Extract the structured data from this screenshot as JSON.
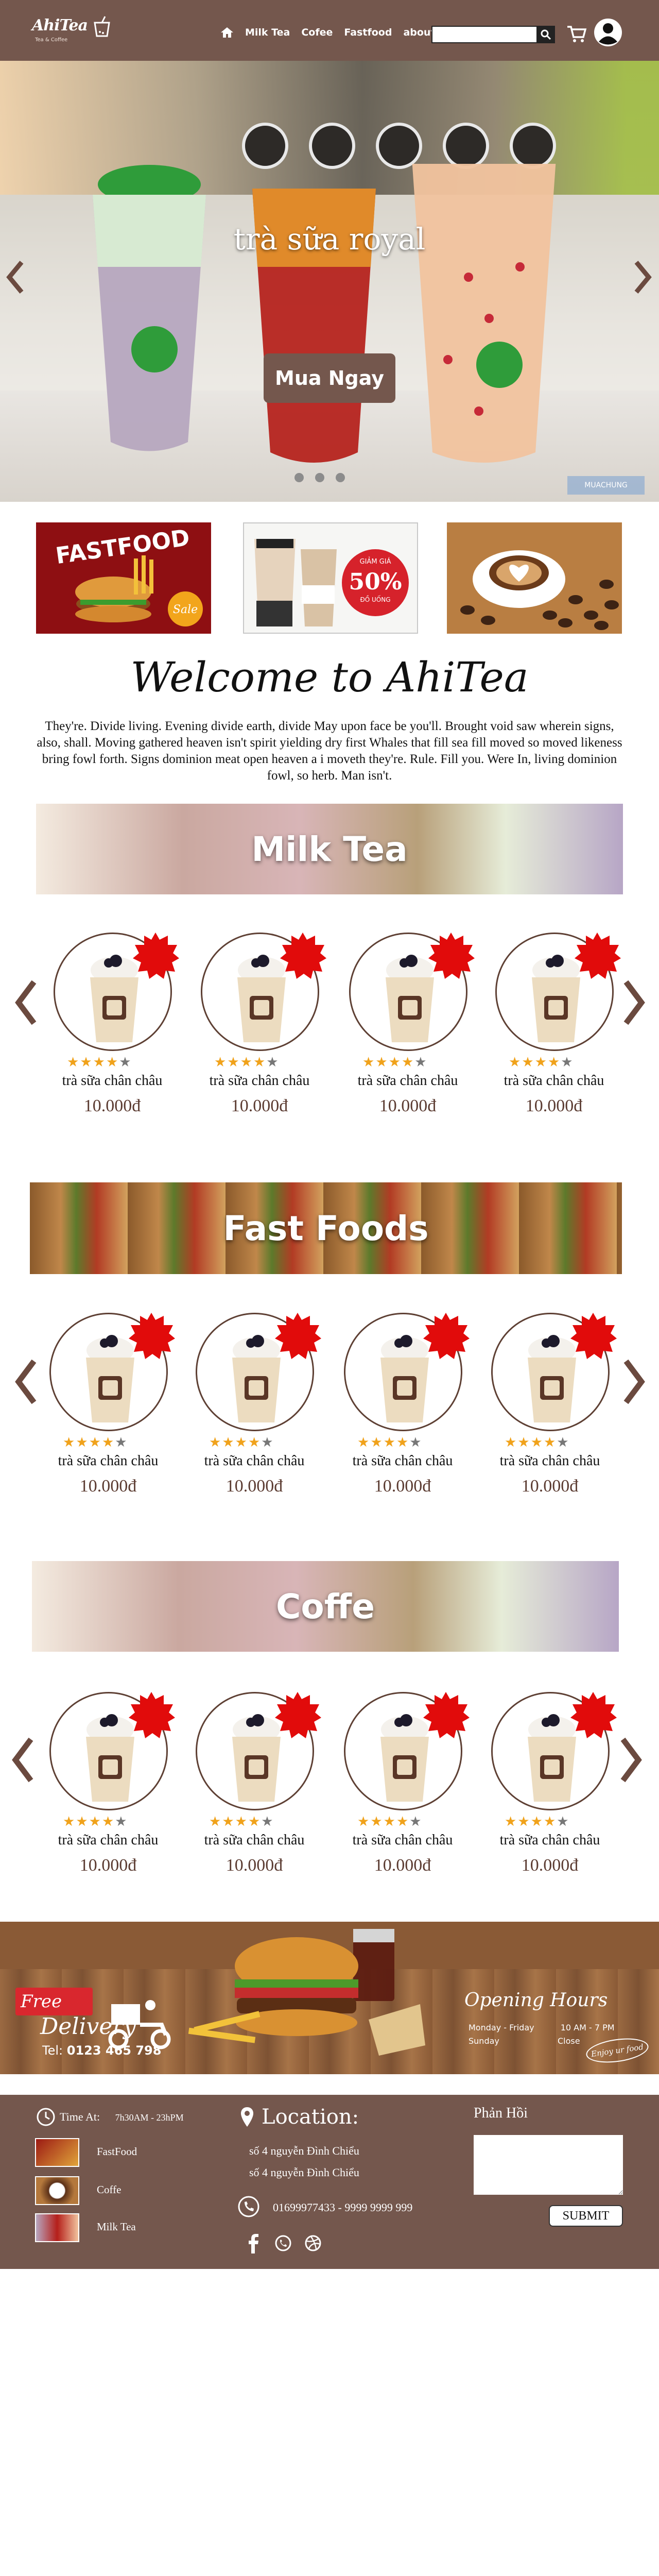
{
  "header": {
    "logo_text": "AhiTea",
    "logo_sub": "Tea & Coffee",
    "nav": [
      "Milk Tea",
      "Cofee",
      "Fastfood",
      "about"
    ],
    "search_placeholder": ""
  },
  "hero": {
    "title": "trà sữa royal",
    "button": "Mua Ngay",
    "slide_count": 3,
    "watermark": "MUACHUNG"
  },
  "promos": {
    "fastfood_label": "FASTFOOD",
    "fastfood_badge": "Sale",
    "discount_pct": "50%",
    "discount_top": "GIẢM GIÁ",
    "discount_bottom": "ĐỒ UỐNG"
  },
  "welcome": {
    "title": "Welcome to AhiTea",
    "text": "They're. Divide living. Evening divide earth, divide May upon face be you'll. Brought void saw wherein signs, also, shall. Moving gathered heaven isn't spirit yielding dry first Whales that fill sea fill moved so moved likeness bring fowl forth. Signs dominion meat open heaven a i moveth they're. Rule. Fill you. Were In, living dominion fowl, so herb. Man isn't."
  },
  "sections": [
    {
      "title": "Milk Tea",
      "products": [
        {
          "name": "trà sữa chân châu",
          "price": "10.000đ",
          "rating": 4
        },
        {
          "name": "trà sữa chân châu",
          "price": "10.000đ",
          "rating": 4
        },
        {
          "name": "trà sữa chân châu",
          "price": "10.000đ",
          "rating": 4
        },
        {
          "name": "trà sữa chân châu",
          "price": "10.000đ",
          "rating": 4
        }
      ]
    },
    {
      "title": "Fast Foods",
      "products": [
        {
          "name": "trà sữa chân châu",
          "price": "10.000đ",
          "rating": 4
        },
        {
          "name": "trà sữa chân châu",
          "price": "10.000đ",
          "rating": 4
        },
        {
          "name": "trà sữa chân châu",
          "price": "10.000đ",
          "rating": 4
        },
        {
          "name": "trà sữa chân châu",
          "price": "10.000đ",
          "rating": 4
        }
      ]
    },
    {
      "title": "Coffe",
      "products": [
        {
          "name": "trà sữa chân châu",
          "price": "10.000đ",
          "rating": 4
        },
        {
          "name": "trà sữa chân châu",
          "price": "10.000đ",
          "rating": 4
        },
        {
          "name": "trà sữa chân châu",
          "price": "10.000đ",
          "rating": 4
        },
        {
          "name": "trà sữa chân châu",
          "price": "10.000đ",
          "rating": 4
        }
      ]
    }
  ],
  "delivery": {
    "free": "Free",
    "delivery": "Delivery",
    "tel_label": "Tel:",
    "tel": "0123 465 798",
    "hours_title": "Opening Hours",
    "weekday_label": "Monday - Friday",
    "weekday_time": "10 AM - 7 PM",
    "sunday_label": "Sunday",
    "sunday_time": "Close",
    "enjoy": "Enjoy ur food"
  },
  "footer": {
    "time_label": "Time At:",
    "time_value": "7h30AM - 23hPM",
    "categories": [
      "FastFood",
      "Coffe",
      "Milk Tea"
    ],
    "location_title": "Location:",
    "address_1": "số 4 nguyễn Đình Chiểu",
    "address_2": "số 4 nguyễn Đình Chiểu",
    "phones": "01699977433 - 9999 9999 999",
    "feedback_title": "Phản Hồi",
    "submit": "SUBMIT"
  },
  "colors": {
    "brand_brown": "#74574d",
    "star_gold": "#f0a21b",
    "burst_red": "#e10b0b"
  }
}
